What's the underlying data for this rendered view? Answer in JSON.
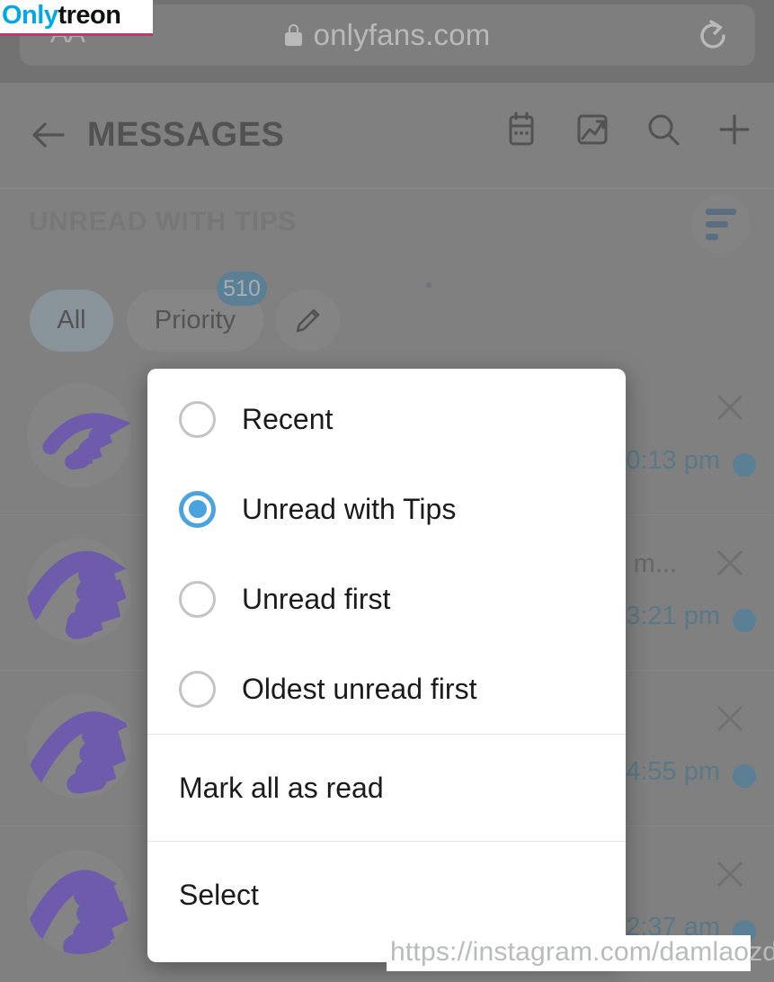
{
  "browser": {
    "text_size_button": "AA",
    "lock_icon": "lock-icon",
    "url": "onlyfans.com",
    "reload_icon": "reload-icon"
  },
  "app_header": {
    "back_icon": "back-arrow-icon",
    "title": "MESSAGES",
    "icons": [
      {
        "name": "calendar-icon"
      },
      {
        "name": "statistics-icon"
      },
      {
        "name": "search-icon"
      },
      {
        "name": "plus-icon"
      }
    ]
  },
  "section": {
    "title": "UNREAD WITH TIPS",
    "sort_icon": "sort-icon"
  },
  "chips": {
    "all": "All",
    "priority": "Priority",
    "priority_badge": "510",
    "edit_icon": "pencil-icon"
  },
  "messages": [
    {
      "time": "0:13 pm",
      "snippet": "",
      "close_icon": "close-icon",
      "unread": true
    },
    {
      "time": "3:21 pm",
      "snippet": "m...",
      "close_icon": "close-icon",
      "unread": true
    },
    {
      "time": "4:55 pm",
      "snippet": "",
      "close_icon": "close-icon",
      "unread": true
    },
    {
      "time": "2:37 am",
      "snippet": "",
      "close_icon": "close-icon",
      "unread": true
    }
  ],
  "dialog": {
    "options": [
      {
        "label": "Recent",
        "selected": false
      },
      {
        "label": "Unread with Tips",
        "selected": true
      },
      {
        "label": "Unread first",
        "selected": false
      },
      {
        "label": "Oldest unread first",
        "selected": false
      }
    ],
    "actions": [
      {
        "label": "Mark all as read"
      },
      {
        "label": "Select"
      }
    ]
  },
  "watermarks": {
    "top_brand_part1": "Only",
    "top_brand_part2": "treon",
    "bottom_url": "https://instagram.com/damlaozden"
  },
  "colors": {
    "accent_blue": "#2f7fad",
    "radio_blue": "#4aa3dd",
    "chip_active": "#93aeb8",
    "brand_cyan": "#00a8e8",
    "dim_gray": "#808080"
  }
}
